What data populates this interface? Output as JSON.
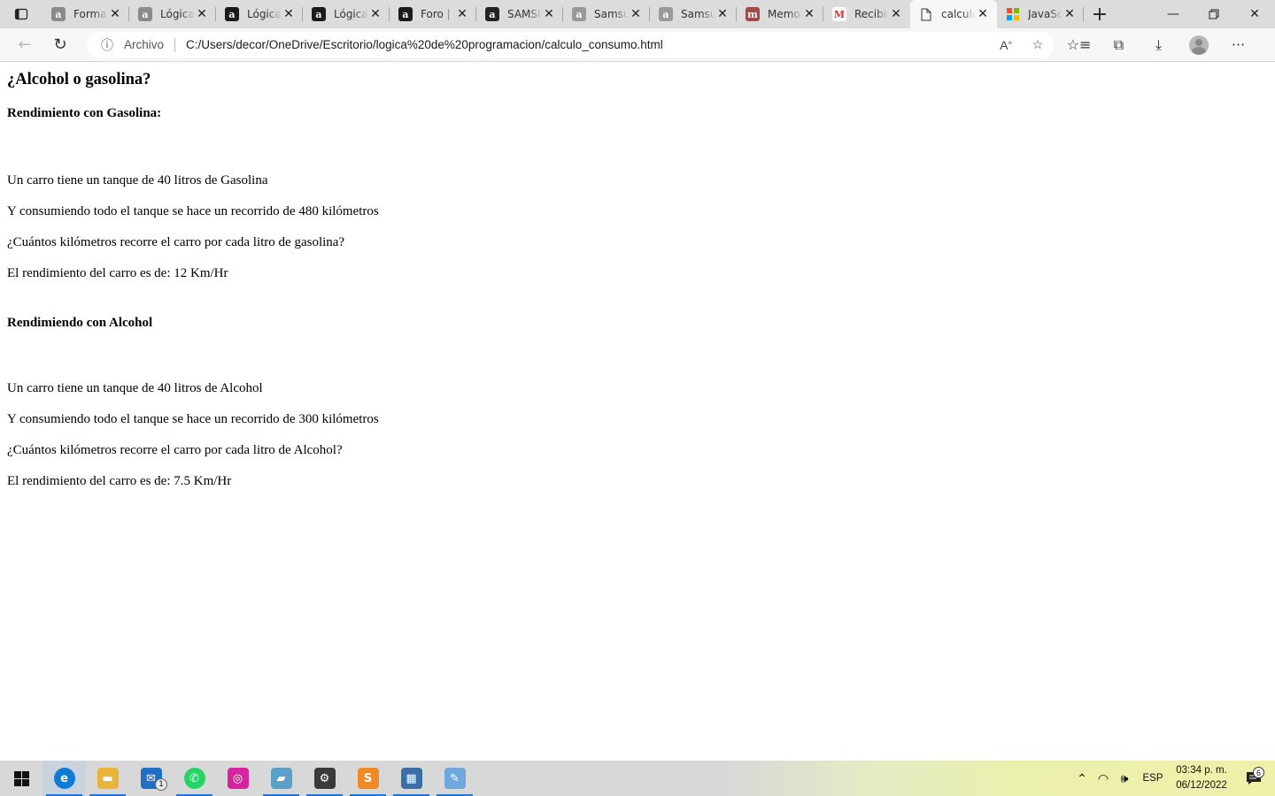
{
  "browser": {
    "tabs": [
      {
        "title": "Formación",
        "favicon": "a",
        "favicon_color": "#8a8a8a",
        "active": false
      },
      {
        "title": "Lógica",
        "favicon": "a",
        "favicon_color": "#8a8a8a",
        "active": false
      },
      {
        "title": "Lógica",
        "favicon": "a",
        "favicon_color": "#1b1b1b",
        "active": false
      },
      {
        "title": "Lógica",
        "favicon": "a",
        "favicon_color": "#1b1b1b",
        "active": false
      },
      {
        "title": "Foro |",
        "favicon": "a",
        "favicon_color": "#1b1b1b",
        "active": false
      },
      {
        "title": "SAMSUNG",
        "favicon": "a",
        "favicon_color": "#222222",
        "active": false
      },
      {
        "title": "Samsung",
        "favicon": "a",
        "favicon_color": "#999999",
        "active": false
      },
      {
        "title": "Samsung",
        "favicon": "a",
        "favicon_color": "#999999",
        "active": false
      },
      {
        "title": "Memoria",
        "favicon": "m",
        "favicon_color": "#a14a4a",
        "active": false
      },
      {
        "title": "Recibidos",
        "favicon": "M",
        "favicon_color": "#d93025",
        "active": false
      },
      {
        "title": "calculo",
        "favicon": "doc",
        "favicon_color": "#ffffff",
        "active": true
      },
      {
        "title": "JavaScript",
        "favicon": "ms",
        "favicon_color": "#7fba00",
        "active": false
      }
    ],
    "address_bar": {
      "site_label": "Archivo",
      "url": "C:/Users/decor/OneDrive/Escritorio/logica%20de%20programacion/calculo_consumo.html"
    }
  },
  "page": {
    "title": "¿Alcohol o gasolina?",
    "gasoline": {
      "heading": "Rendimiento con Gasolina:",
      "line1": "Un carro tiene un tanque de 40 litros de Gasolina",
      "line2": "Y consumiendo todo el tanque se hace un recorrido de 480 kilómetros",
      "line3": "¿Cuántos kilómetros recorre el carro por cada litro de gasolina?",
      "result": "El rendimiento del carro es de: 12 Km/Hr"
    },
    "alcohol": {
      "heading": "Rendimiendo con Alcohol",
      "line1": "Un carro tiene un tanque de 40 litros de Alcohol",
      "line2": "Y consumiendo todo el tanque se hace un recorrido de 300 kilómetros",
      "line3": "¿Cuántos kilómetros recorre el carro por cada litro de Alcohol?",
      "result": "El rendimiento del carro es de: 7.5 Km/Hr"
    }
  },
  "taskbar": {
    "apps": [
      {
        "name": "edge",
        "color": "#0f7bd3",
        "glyph": "e",
        "active": true,
        "running": true
      },
      {
        "name": "file-explorer",
        "color": "#e8b53a",
        "glyph": "▬",
        "active": false,
        "running": true
      },
      {
        "name": "mail",
        "color": "#1f6fc7",
        "glyph": "✉",
        "active": false,
        "running": false,
        "badge": "1"
      },
      {
        "name": "whatsapp",
        "color": "#25d366",
        "glyph": "✆",
        "active": false,
        "running": true
      },
      {
        "name": "instagram",
        "color": "#d6249f",
        "glyph": "◎",
        "active": false,
        "running": false
      },
      {
        "name": "notes",
        "color": "#5aa0c8",
        "glyph": "▰",
        "active": false,
        "running": true
      },
      {
        "name": "settings",
        "color": "#3a3a3a",
        "glyph": "⚙",
        "active": false,
        "running": true
      },
      {
        "name": "sublime-text",
        "color": "#f08a24",
        "glyph": "S",
        "active": false,
        "running": true
      },
      {
        "name": "calculator",
        "color": "#3a6ea5",
        "glyph": "▦",
        "active": false,
        "running": true
      },
      {
        "name": "paint",
        "color": "#6fa8dc",
        "glyph": "✎",
        "active": false,
        "running": true
      }
    ],
    "tray": {
      "language": "ESP",
      "time": "03:34 p. m.",
      "date": "06/12/2022",
      "notification_count": "6"
    }
  }
}
